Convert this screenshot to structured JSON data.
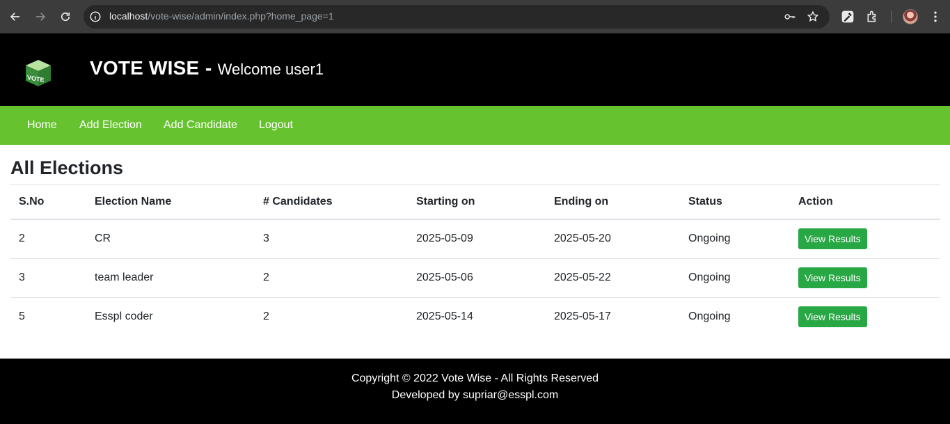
{
  "browser": {
    "url_host": "localhost",
    "url_path": "/vote-wise/admin/index.php?home_page=1"
  },
  "header": {
    "logo_text": "VOTE",
    "brand": "VOTE WISE",
    "separator": "-",
    "welcome": "Welcome user1"
  },
  "nav": {
    "items": [
      {
        "label": "Home"
      },
      {
        "label": "Add Election"
      },
      {
        "label": "Add Candidate"
      },
      {
        "label": "Logout"
      }
    ]
  },
  "main": {
    "title": "All Elections",
    "table": {
      "headers": [
        "S.No",
        "Election Name",
        "# Candidates",
        "Starting on",
        "Ending on",
        "Status",
        "Action"
      ],
      "rows": [
        {
          "sno": "2",
          "name": "CR",
          "candidates": "3",
          "start": "2025-05-09",
          "end": "2025-05-20",
          "status": "Ongoing",
          "action": "View Results"
        },
        {
          "sno": "3",
          "name": "team leader",
          "candidates": "2",
          "start": "2025-05-06",
          "end": "2025-05-22",
          "status": "Ongoing",
          "action": "View Results"
        },
        {
          "sno": "5",
          "name": "Esspl coder",
          "candidates": "2",
          "start": "2025-05-14",
          "end": "2025-05-17",
          "status": "Ongoing",
          "action": "View Results"
        }
      ]
    }
  },
  "footer": {
    "copyright": "Copyright © 2022 Vote Wise - All Rights Reserved",
    "developer": "Developed by supriar@esspl.com"
  },
  "colors": {
    "nav_green": "#67c230",
    "button_green": "#28a745",
    "header_bg": "#000000"
  }
}
